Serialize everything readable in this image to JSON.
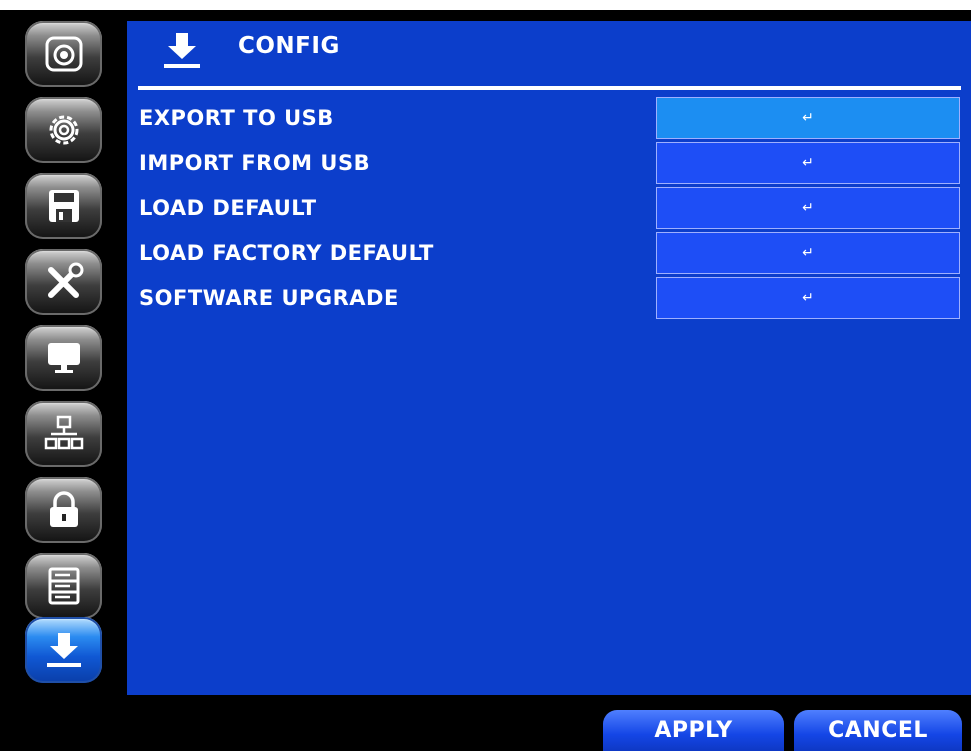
{
  "header": {
    "title": "CONFIG",
    "icon": "download-icon"
  },
  "sidebar": {
    "items": [
      {
        "icon": "camera-icon",
        "active": false
      },
      {
        "icon": "gear-icon",
        "active": false
      },
      {
        "icon": "floppy-disk-icon",
        "active": false
      },
      {
        "icon": "tools-icon",
        "active": false
      },
      {
        "icon": "monitor-icon",
        "active": false
      },
      {
        "icon": "network-icon",
        "active": false
      },
      {
        "icon": "lock-icon",
        "active": false
      },
      {
        "icon": "storage-icon",
        "active": false
      },
      {
        "icon": "download-icon",
        "active": true
      }
    ]
  },
  "rows": [
    {
      "label": "EXPORT TO USB",
      "action": "↵",
      "selected": true
    },
    {
      "label": "IMPORT FROM USB",
      "action": "↵",
      "selected": false
    },
    {
      "label": "LOAD DEFAULT",
      "action": "↵",
      "selected": false
    },
    {
      "label": "LOAD FACTORY DEFAULT",
      "action": "↵",
      "selected": false
    },
    {
      "label": "SOFTWARE UPGRADE",
      "action": "↵",
      "selected": false
    }
  ],
  "footer": {
    "apply_label": "APPLY",
    "cancel_label": "CANCEL"
  },
  "colors": {
    "panel": "#0c3ecb",
    "row_button": "#1e4ef6",
    "row_selected": "#1c8ef2",
    "background": "#000000"
  }
}
